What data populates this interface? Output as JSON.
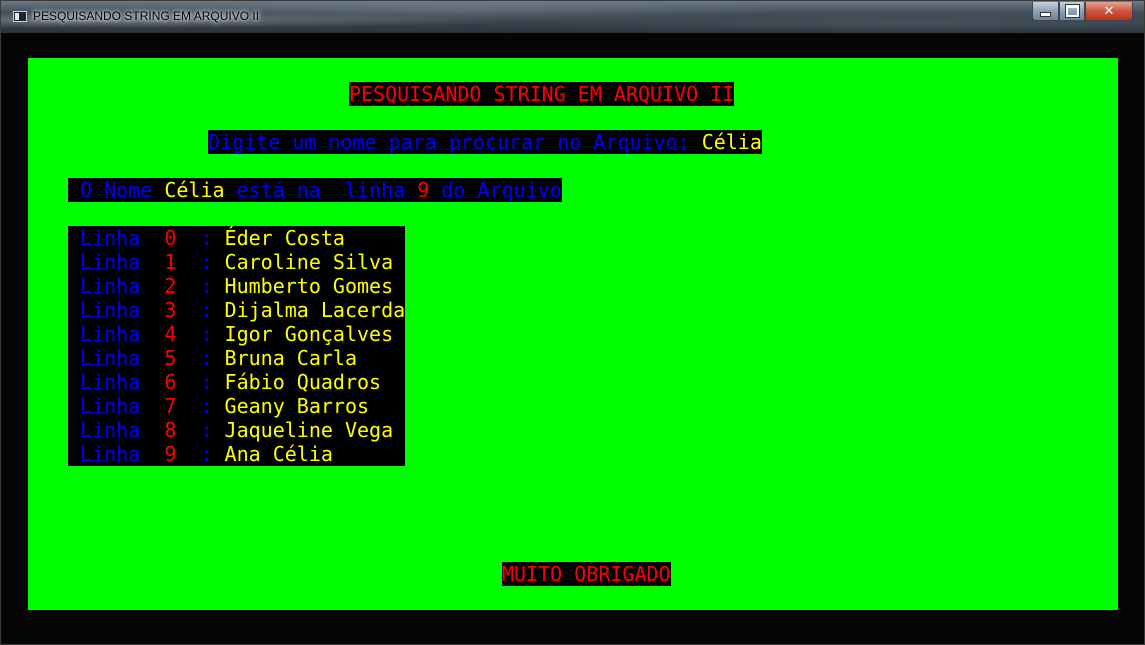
{
  "window": {
    "title": "PESQUISANDO STRING EM ARQUIVO II",
    "minimize_icon": "minimize-icon",
    "maximize_icon": "maximize-icon",
    "close_icon": "close-icon",
    "close_glyph": "✕"
  },
  "console": {
    "background": "#00ff00",
    "heading": "PESQUISANDO STRING EM ARQUIVO II",
    "prompt": {
      "label": "Digite um nome para procurar no Arquivo: ",
      "value": "Célia"
    },
    "result": {
      "prefix": " O Nome ",
      "name": "Célia",
      "middle": " está na  linha ",
      "line_number": "9",
      "suffix": " do Arquivo"
    },
    "rows": [
      {
        "label": " Linha  ",
        "index": "0",
        "sep": "  : ",
        "name": "Éder Costa   "
      },
      {
        "label": " Linha  ",
        "index": "1",
        "sep": "  : ",
        "name": "Caroline Silva"
      },
      {
        "label": " Linha  ",
        "index": "2",
        "sep": "  : ",
        "name": "Humberto Gomes"
      },
      {
        "label": " Linha  ",
        "index": "3",
        "sep": "  : ",
        "name": "Dijalma Lacerda"
      },
      {
        "label": " Linha  ",
        "index": "4",
        "sep": "  : ",
        "name": "Igor Gonçalves "
      },
      {
        "label": " Linha  ",
        "index": "5",
        "sep": "  : ",
        "name": "Bruna Carla    "
      },
      {
        "label": " Linha  ",
        "index": "6",
        "sep": "  : ",
        "name": "Fábio Quadros  "
      },
      {
        "label": " Linha  ",
        "index": "7",
        "sep": "  : ",
        "name": "Geany Barros   "
      },
      {
        "label": " Linha  ",
        "index": "8",
        "sep": "  : ",
        "name": "Jaqueline Vega "
      },
      {
        "label": " Linha  ",
        "index": "9",
        "sep": "  : ",
        "name": "Ana Célia "
      }
    ],
    "footer": "MUITO OBRIGADO"
  }
}
